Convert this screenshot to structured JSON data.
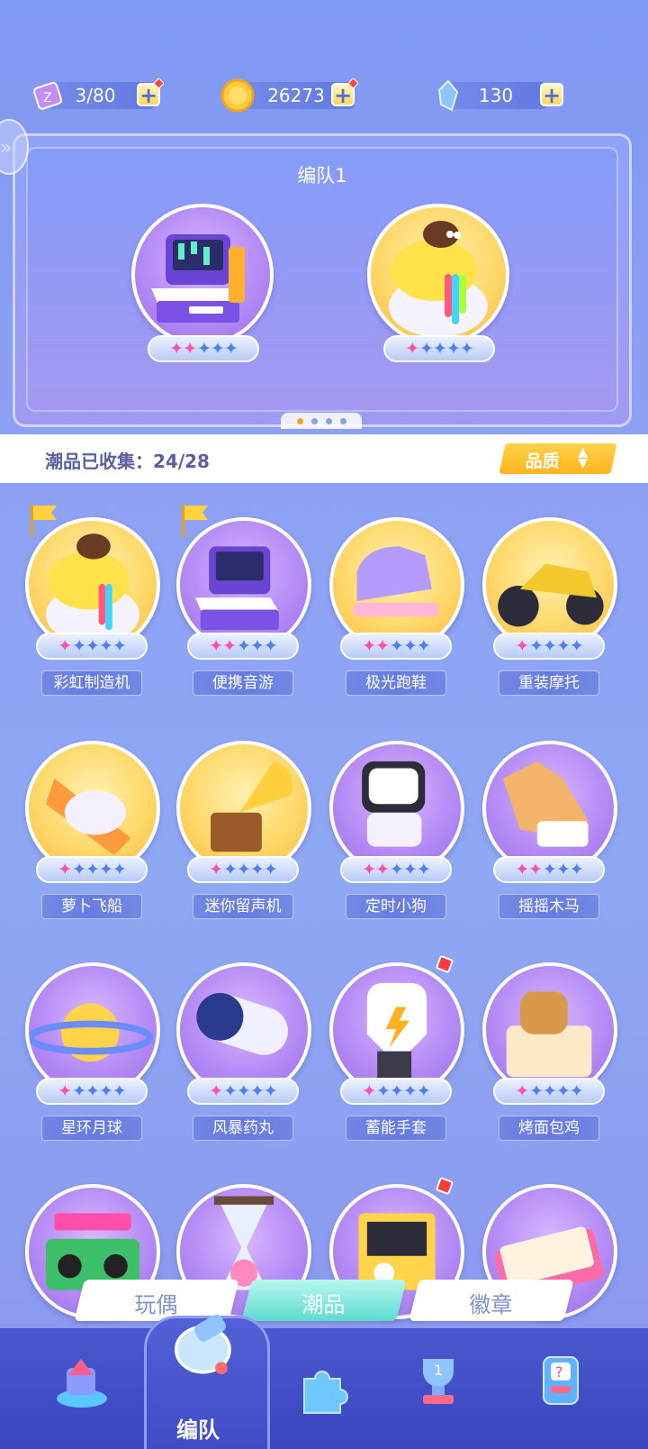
{
  "currencies": [
    {
      "name": "ticket",
      "value": "3/80",
      "icon": "ticket-icon"
    },
    {
      "name": "coin",
      "value": "26273",
      "icon": "coin-icon"
    },
    {
      "name": "crystal",
      "value": "130",
      "icon": "crystal-icon"
    }
  ],
  "team": {
    "title": "编队1",
    "members": [
      {
        "icon": "piano-machine-icon",
        "stars_pink": 2,
        "stars_total": 5
      },
      {
        "icon": "rainbow-blob-icon",
        "stars_pink": 1,
        "stars_total": 5
      }
    ],
    "page_count": 4,
    "active_page": 1
  },
  "collection": {
    "label": "潮品已收集：24/28",
    "sort_button": "品质"
  },
  "items": [
    {
      "name": "彩虹制造机",
      "stars_pink": 1,
      "bg": "gold",
      "flag": true
    },
    {
      "name": "便携音游",
      "stars_pink": 2,
      "bg": "purple",
      "flag": true
    },
    {
      "name": "极光跑鞋",
      "stars_pink": 2,
      "bg": "gold"
    },
    {
      "name": "重装摩托",
      "stars_pink": 1,
      "bg": "gold"
    },
    {
      "name": "萝卜飞船",
      "stars_pink": 1,
      "bg": "gold"
    },
    {
      "name": "迷你留声机",
      "stars_pink": 1,
      "bg": "gold"
    },
    {
      "name": "定时小狗",
      "stars_pink": 2,
      "bg": "purple"
    },
    {
      "name": "摇摇木马",
      "stars_pink": 2,
      "bg": "purple"
    },
    {
      "name": "星环月球",
      "stars_pink": 1,
      "bg": "purple"
    },
    {
      "name": "风暴药丸",
      "stars_pink": 1,
      "bg": "purple"
    },
    {
      "name": "蓄能手套",
      "stars_pink": 1,
      "bg": "purple",
      "badge": true
    },
    {
      "name": "烤面包鸡",
      "stars_pink": 1,
      "bg": "purple"
    },
    {
      "name": "",
      "stars_pink": 0,
      "bg": "purple"
    },
    {
      "name": "",
      "stars_pink": 0,
      "bg": "purple"
    },
    {
      "name": "",
      "stars_pink": 0,
      "bg": "purple",
      "badge": true
    },
    {
      "name": "",
      "stars_pink": 0,
      "bg": "purple"
    }
  ],
  "tabs": [
    {
      "label": "玩偶",
      "active": false
    },
    {
      "label": "潮品",
      "active": true
    },
    {
      "label": "徽章",
      "active": false
    }
  ],
  "nav": {
    "active_label": "编队",
    "items": [
      "home-icon",
      "whistle-icon",
      "puzzle-icon",
      "trophy-icon",
      "mystery-machine-icon"
    ]
  },
  "colors": {
    "star_pink": "#ff4fa8",
    "star_blue": "#4f7ff0",
    "accent_gold": "#ffc12e",
    "active_tab": "#5ddcd0"
  }
}
